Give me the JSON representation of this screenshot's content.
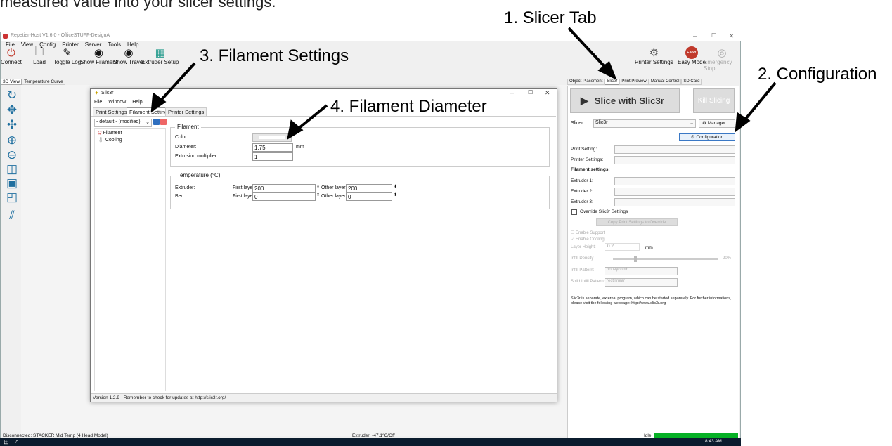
{
  "callouts": {
    "partial_instruction": "measured value into your slicer settings.",
    "slicer_tab": "1. Slicer Tab",
    "configuration": "2. Configuration",
    "filament_settings": "3. Filament Settings",
    "filament_diameter": "4. Filament Diameter"
  },
  "app": {
    "title": "Repetier-Host V1.6.0 - OfficeSTUFF-DesignA",
    "menu": [
      "File",
      "View",
      "Config",
      "Printer",
      "Server",
      "Tools",
      "Help"
    ],
    "toolbar": [
      "Connect",
      "Load",
      "Toggle Log",
      "Show Filament",
      "Show Travel",
      "Extruder Setup"
    ],
    "toolbar_right": [
      "Printer Settings",
      "Easy Mode",
      "Emergency Stop"
    ],
    "easy_badge": "EASY",
    "view_tabs": [
      "3D View",
      "Temperature Curve"
    ],
    "right_tabs": [
      "Object Placement",
      "Slicer",
      "Print Preview",
      "Manual Control",
      "SD Card"
    ],
    "status_left": "Disconnected: STACKER Mid Temp (4 Head Model)",
    "status_mid": "Extruder: -47.1°C/Off",
    "status_right": "Idle",
    "clock": "8:43 AM"
  },
  "slicer_panel": {
    "slice_button": "Slice with Slic3r",
    "kill_button": "Kill Slicing",
    "slicer_label": "Slicer:",
    "slicer_value": "Slic3r",
    "manager_button": "Manager",
    "configuration_button": "Configuration",
    "print_setting_label": "Print Setting:",
    "printer_settings_label": "Printer Settings:",
    "filament_heading": "Filament settings:",
    "extruder1": "Extruder 1:",
    "extruder2": "Extruder 2:",
    "extruder3": "Extruder 3:",
    "override_label": "Override Slic3r Settings",
    "copy_button": "Copy Print Settings to Override",
    "enable_support": "Enable Support",
    "enable_cooling": "Enable Cooling",
    "layer_height_label": "Layer Height:",
    "layer_height_value": "0.2",
    "layer_height_unit": "mm",
    "infill_density_label": "Infill Density",
    "infill_density_value": "20%",
    "infill_pattern_label": "Infill Pattern:",
    "infill_pattern_value": "honeycomb",
    "solid_infill_label": "Solid Infill Pattern:",
    "solid_infill_value": "rectilinear",
    "info_text": "Slic3r is separate, external program, which can be started separately. For further informations, please visit the following webpage: http://www.slic3r.org"
  },
  "slic3r": {
    "title": "Slic3r",
    "menu": [
      "File",
      "Window",
      "Help"
    ],
    "tabs": [
      "Print Settings",
      "Filament Settings",
      "Printer Settings"
    ],
    "preset": "- default - (modified)",
    "tree": [
      "Filament",
      "Cooling"
    ],
    "filament_group": "Filament",
    "color_label": "Color:",
    "diameter_label": "Diameter:",
    "diameter_value": "1.75",
    "diameter_unit": "mm",
    "extrusion_label": "Extrusion multiplier:",
    "extrusion_value": "1",
    "temp_group": "Temperature (°C)",
    "extruder_label": "Extruder:",
    "bed_label": "Bed:",
    "first_layer_label": "First layer:",
    "other_layers_label": "Other layers:",
    "extruder_first": "200",
    "extruder_other": "200",
    "bed_first": "0",
    "bed_other": "0",
    "status": "Version 1.2.9 - Remember to check for updates at http://slic3r.org/"
  }
}
